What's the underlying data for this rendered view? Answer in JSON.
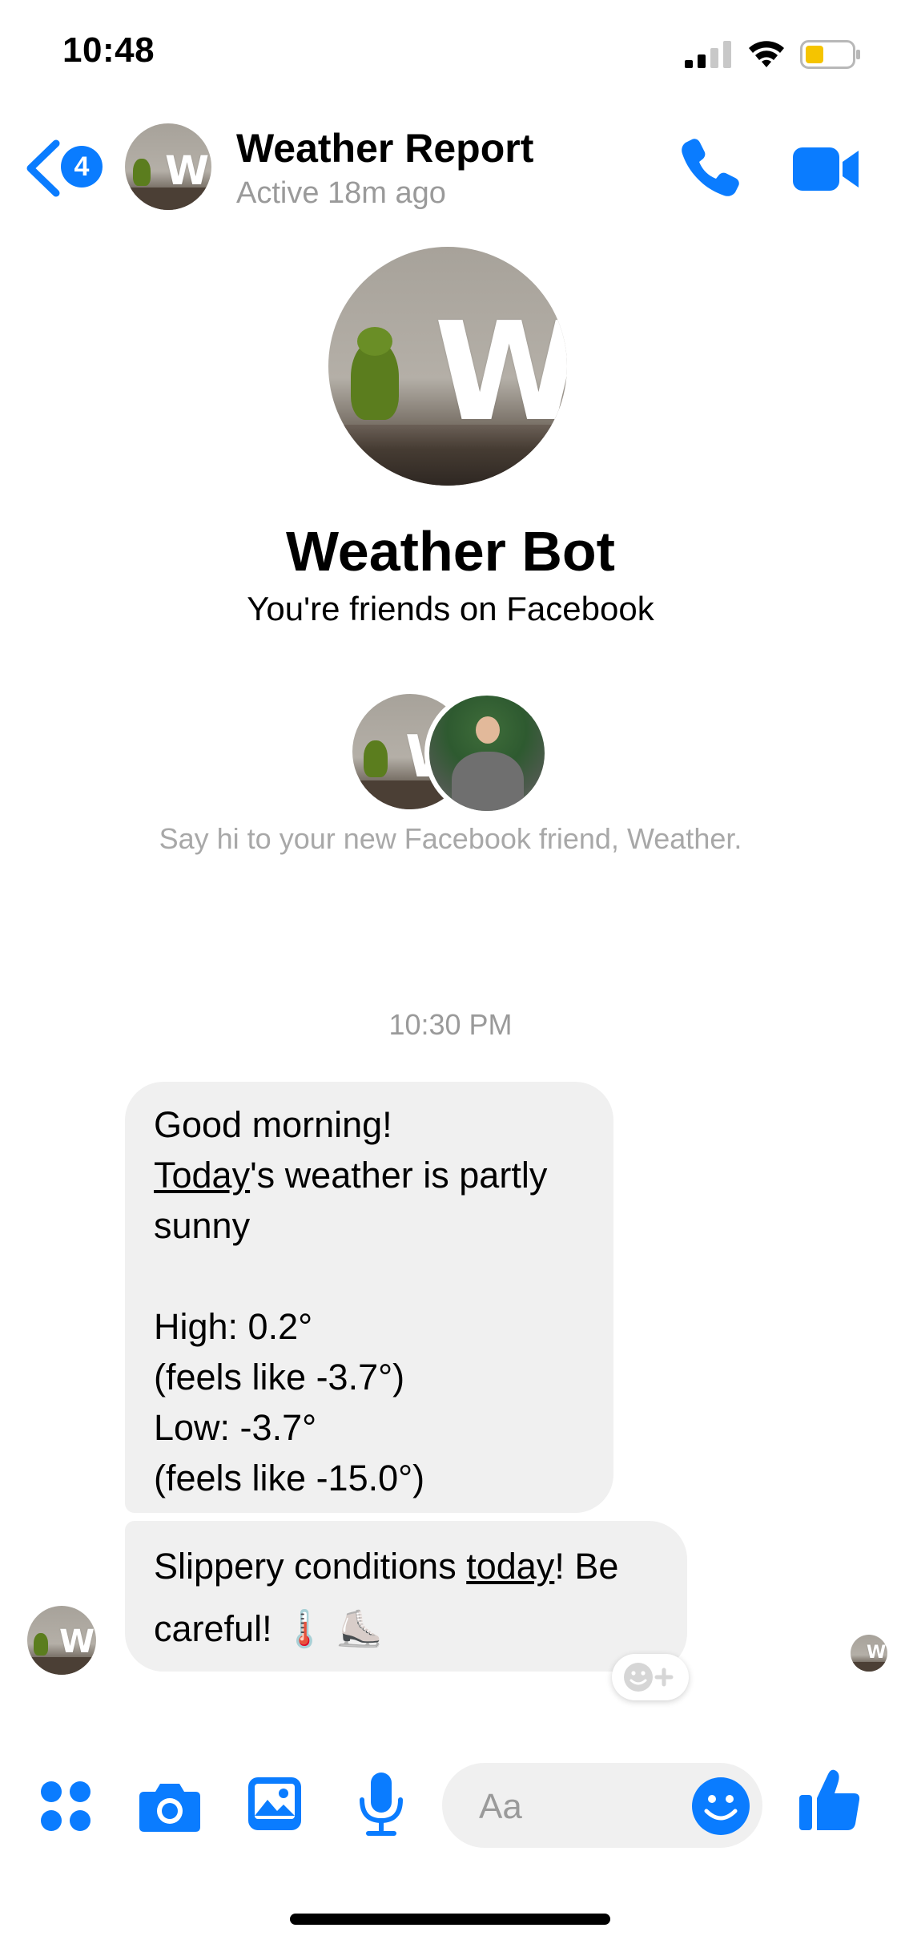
{
  "status": {
    "time": "10:48"
  },
  "header": {
    "back_badge": "4",
    "title": "Weather Report",
    "subtitle": "Active 18m ago",
    "avatar_letter": "W"
  },
  "profile": {
    "name": "Weather Bot",
    "relation": "You're friends on Facebook",
    "hint": "Say hi to your new Facebook friend, Weather."
  },
  "conversation": {
    "timestamp": "10:30 PM",
    "message1": {
      "l1": "Good morning!",
      "l2_link": "Today",
      "l2_rest": "'s weather is partly",
      "l3": "sunny",
      "l4": "",
      "l5": "High: 0.2°",
      "l6": "(feels like -3.7°)",
      "l7": "Low: -3.7°",
      "l8": "(feels like -15.0°)"
    },
    "message2": {
      "pre": "Slippery conditions ",
      "link": "today",
      "post": "! Be",
      "l2": "careful! ",
      "emoji": "🌡️ ⛸️"
    }
  },
  "composer": {
    "placeholder": "Aa"
  },
  "colors": {
    "accent": "#0a7cff",
    "bubble": "#f0f0f0",
    "battery": "#f5c400"
  },
  "icons": [
    "chevron-left-icon",
    "phone-icon",
    "video-camera-icon",
    "apps-grid-icon",
    "camera-icon",
    "image-icon",
    "microphone-icon",
    "emoji-icon",
    "thumbs-up-icon",
    "add-reaction-icon",
    "wifi-icon",
    "signal-icon",
    "battery-icon"
  ]
}
